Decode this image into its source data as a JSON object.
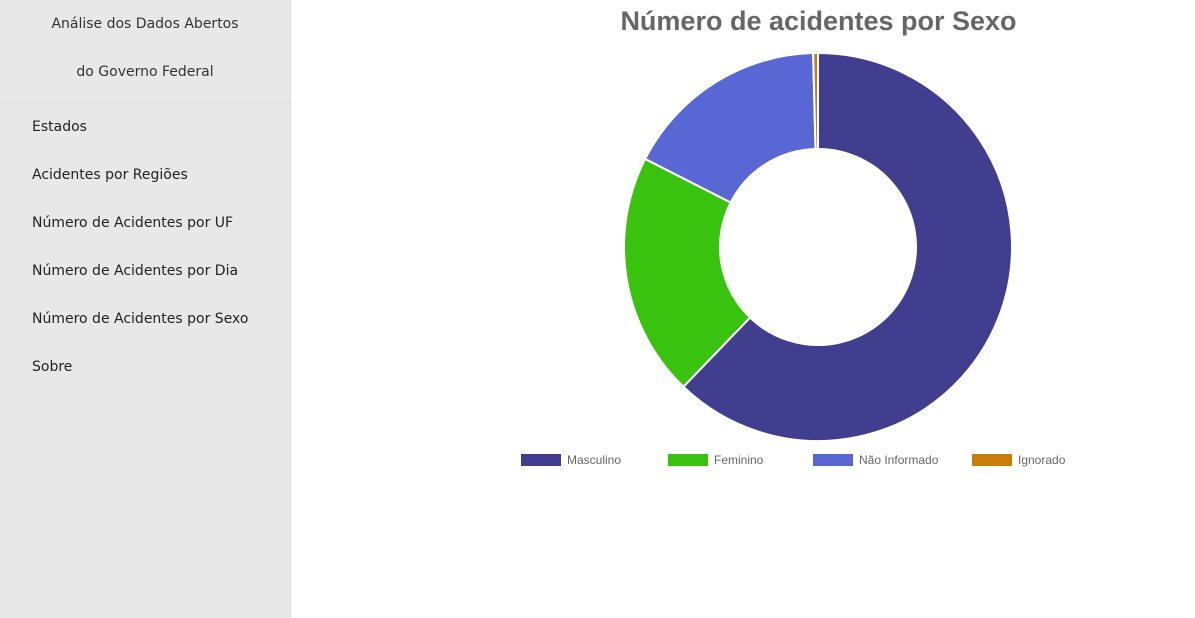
{
  "sidebar": {
    "brand_line1": "Análise dos Dados Abertos",
    "brand_line2": "do Governo Federal",
    "items": [
      {
        "label": "Estados",
        "name": "nav-estados"
      },
      {
        "label": "Acidentes por Regiões",
        "name": "nav-acidentes-por-regioes"
      },
      {
        "label": "Número de Acidentes por UF",
        "name": "nav-acidentes-por-uf"
      },
      {
        "label": "Número de Acidentes por Dia",
        "name": "nav-acidentes-por-dia"
      },
      {
        "label": "Número de Acidentes por Sexo",
        "name": "nav-acidentes-por-sexo"
      },
      {
        "label": "Sobre",
        "name": "nav-sobre"
      }
    ]
  },
  "chart_data": {
    "type": "pie",
    "variant": "doughnut",
    "title": "Número de acidentes por Sexo",
    "categories": [
      "Masculino",
      "Feminino",
      "Não Informado",
      "Ignorado"
    ],
    "values": [
      62.2,
      20.3,
      17.1,
      0.4
    ],
    "colors": [
      "#413d8f",
      "#39c30e",
      "#5967d4",
      "#c97e08"
    ],
    "legend_position": "bottom"
  }
}
